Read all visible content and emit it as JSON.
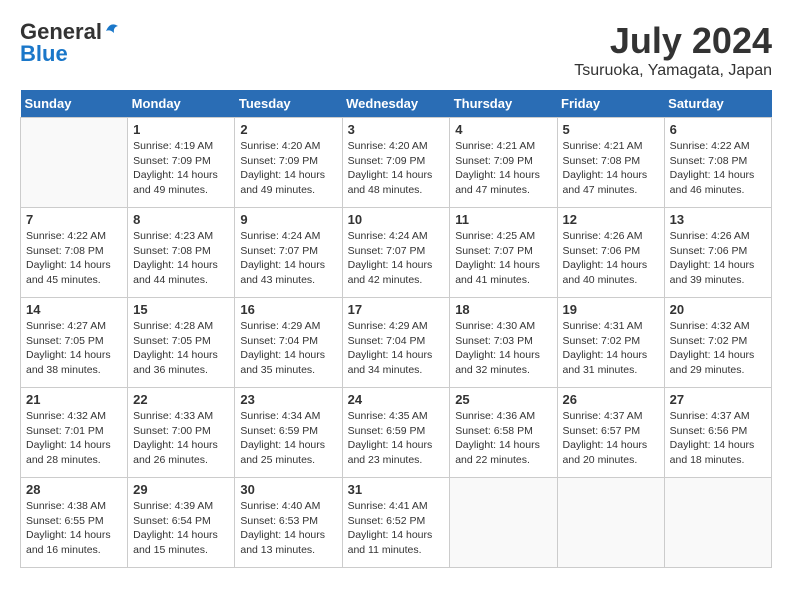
{
  "header": {
    "logo_general": "General",
    "logo_blue": "Blue",
    "month_year": "July 2024",
    "location": "Tsuruoka, Yamagata, Japan"
  },
  "days_of_week": [
    "Sunday",
    "Monday",
    "Tuesday",
    "Wednesday",
    "Thursday",
    "Friday",
    "Saturday"
  ],
  "weeks": [
    [
      {
        "day": "",
        "info": ""
      },
      {
        "day": "1",
        "info": "Sunrise: 4:19 AM\nSunset: 7:09 PM\nDaylight: 14 hours\nand 49 minutes."
      },
      {
        "day": "2",
        "info": "Sunrise: 4:20 AM\nSunset: 7:09 PM\nDaylight: 14 hours\nand 49 minutes."
      },
      {
        "day": "3",
        "info": "Sunrise: 4:20 AM\nSunset: 7:09 PM\nDaylight: 14 hours\nand 48 minutes."
      },
      {
        "day": "4",
        "info": "Sunrise: 4:21 AM\nSunset: 7:09 PM\nDaylight: 14 hours\nand 47 minutes."
      },
      {
        "day": "5",
        "info": "Sunrise: 4:21 AM\nSunset: 7:08 PM\nDaylight: 14 hours\nand 47 minutes."
      },
      {
        "day": "6",
        "info": "Sunrise: 4:22 AM\nSunset: 7:08 PM\nDaylight: 14 hours\nand 46 minutes."
      }
    ],
    [
      {
        "day": "7",
        "info": "Sunrise: 4:22 AM\nSunset: 7:08 PM\nDaylight: 14 hours\nand 45 minutes."
      },
      {
        "day": "8",
        "info": "Sunrise: 4:23 AM\nSunset: 7:08 PM\nDaylight: 14 hours\nand 44 minutes."
      },
      {
        "day": "9",
        "info": "Sunrise: 4:24 AM\nSunset: 7:07 PM\nDaylight: 14 hours\nand 43 minutes."
      },
      {
        "day": "10",
        "info": "Sunrise: 4:24 AM\nSunset: 7:07 PM\nDaylight: 14 hours\nand 42 minutes."
      },
      {
        "day": "11",
        "info": "Sunrise: 4:25 AM\nSunset: 7:07 PM\nDaylight: 14 hours\nand 41 minutes."
      },
      {
        "day": "12",
        "info": "Sunrise: 4:26 AM\nSunset: 7:06 PM\nDaylight: 14 hours\nand 40 minutes."
      },
      {
        "day": "13",
        "info": "Sunrise: 4:26 AM\nSunset: 7:06 PM\nDaylight: 14 hours\nand 39 minutes."
      }
    ],
    [
      {
        "day": "14",
        "info": "Sunrise: 4:27 AM\nSunset: 7:05 PM\nDaylight: 14 hours\nand 38 minutes."
      },
      {
        "day": "15",
        "info": "Sunrise: 4:28 AM\nSunset: 7:05 PM\nDaylight: 14 hours\nand 36 minutes."
      },
      {
        "day": "16",
        "info": "Sunrise: 4:29 AM\nSunset: 7:04 PM\nDaylight: 14 hours\nand 35 minutes."
      },
      {
        "day": "17",
        "info": "Sunrise: 4:29 AM\nSunset: 7:04 PM\nDaylight: 14 hours\nand 34 minutes."
      },
      {
        "day": "18",
        "info": "Sunrise: 4:30 AM\nSunset: 7:03 PM\nDaylight: 14 hours\nand 32 minutes."
      },
      {
        "day": "19",
        "info": "Sunrise: 4:31 AM\nSunset: 7:02 PM\nDaylight: 14 hours\nand 31 minutes."
      },
      {
        "day": "20",
        "info": "Sunrise: 4:32 AM\nSunset: 7:02 PM\nDaylight: 14 hours\nand 29 minutes."
      }
    ],
    [
      {
        "day": "21",
        "info": "Sunrise: 4:32 AM\nSunset: 7:01 PM\nDaylight: 14 hours\nand 28 minutes."
      },
      {
        "day": "22",
        "info": "Sunrise: 4:33 AM\nSunset: 7:00 PM\nDaylight: 14 hours\nand 26 minutes."
      },
      {
        "day": "23",
        "info": "Sunrise: 4:34 AM\nSunset: 6:59 PM\nDaylight: 14 hours\nand 25 minutes."
      },
      {
        "day": "24",
        "info": "Sunrise: 4:35 AM\nSunset: 6:59 PM\nDaylight: 14 hours\nand 23 minutes."
      },
      {
        "day": "25",
        "info": "Sunrise: 4:36 AM\nSunset: 6:58 PM\nDaylight: 14 hours\nand 22 minutes."
      },
      {
        "day": "26",
        "info": "Sunrise: 4:37 AM\nSunset: 6:57 PM\nDaylight: 14 hours\nand 20 minutes."
      },
      {
        "day": "27",
        "info": "Sunrise: 4:37 AM\nSunset: 6:56 PM\nDaylight: 14 hours\nand 18 minutes."
      }
    ],
    [
      {
        "day": "28",
        "info": "Sunrise: 4:38 AM\nSunset: 6:55 PM\nDaylight: 14 hours\nand 16 minutes."
      },
      {
        "day": "29",
        "info": "Sunrise: 4:39 AM\nSunset: 6:54 PM\nDaylight: 14 hours\nand 15 minutes."
      },
      {
        "day": "30",
        "info": "Sunrise: 4:40 AM\nSunset: 6:53 PM\nDaylight: 14 hours\nand 13 minutes."
      },
      {
        "day": "31",
        "info": "Sunrise: 4:41 AM\nSunset: 6:52 PM\nDaylight: 14 hours\nand 11 minutes."
      },
      {
        "day": "",
        "info": ""
      },
      {
        "day": "",
        "info": ""
      },
      {
        "day": "",
        "info": ""
      }
    ]
  ]
}
